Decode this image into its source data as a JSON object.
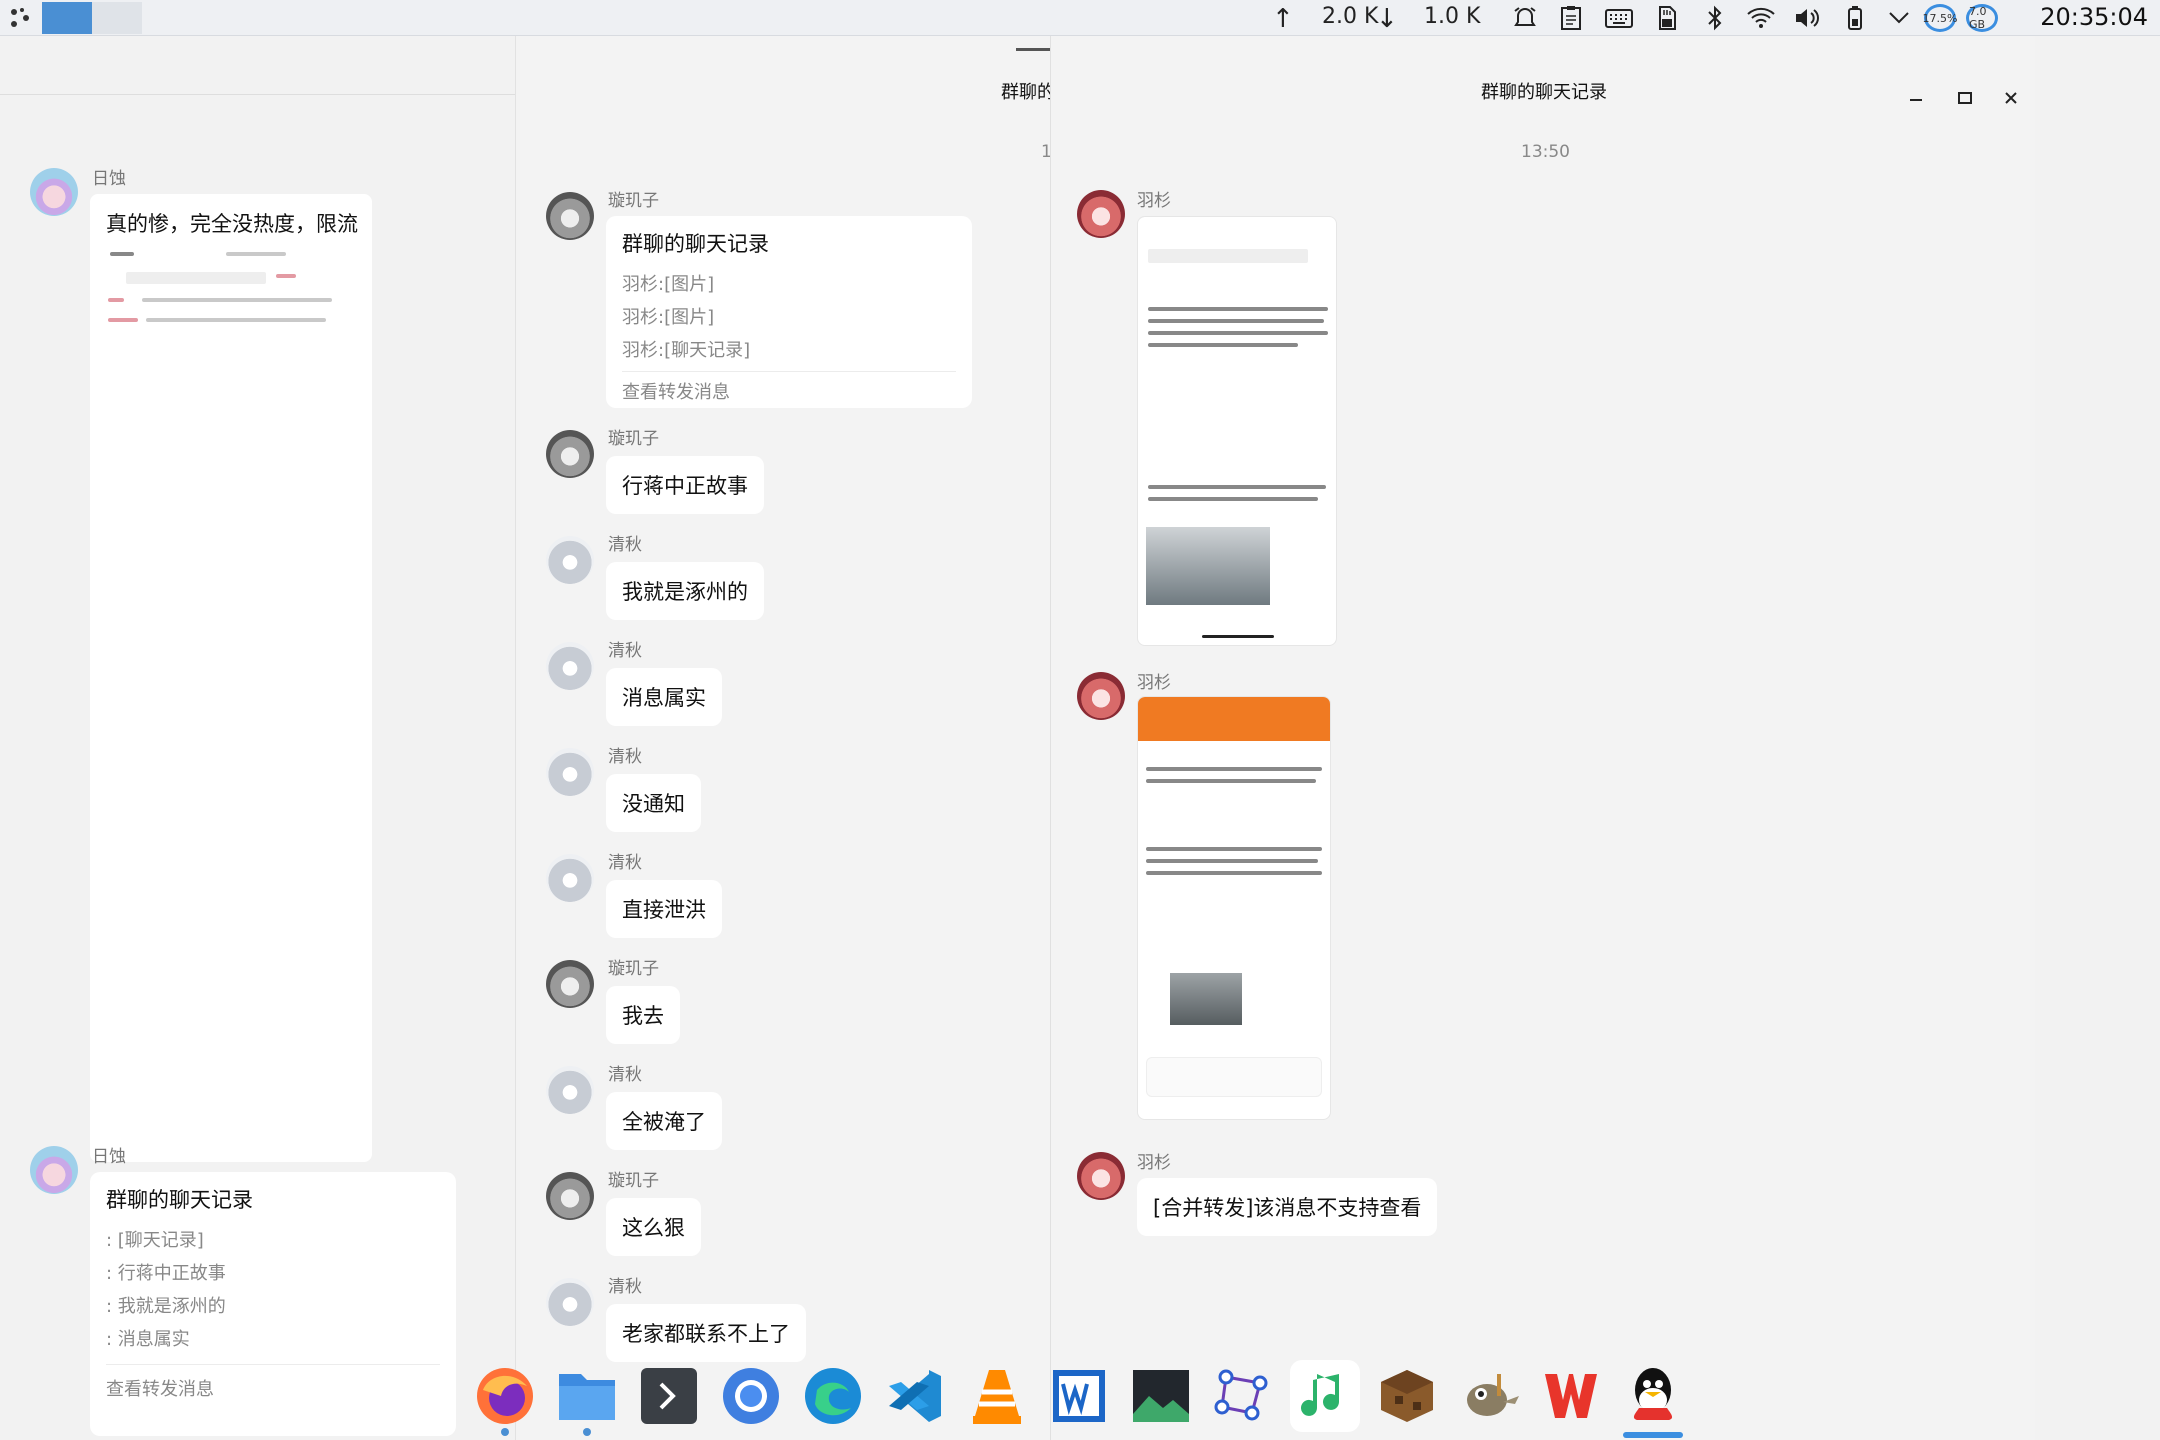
{
  "topbar": {
    "upload_speed": "2.0 K",
    "download_speed": "1.0 K",
    "cpu": "17.5%",
    "mem": "7.0 GB",
    "clock": "20:35:04",
    "icons": [
      "launcher-icon",
      "upload-arrow-icon",
      "download-arrow-icon",
      "alarm-icon",
      "clipboard-icon",
      "keyboard-icon",
      "sd-card-icon",
      "bluetooth-icon",
      "wifi-icon",
      "volume-icon",
      "battery-icon",
      "chevron-down-icon"
    ]
  },
  "left_window": {
    "messages": [
      {
        "sender": "日蚀",
        "text": "真的惨，完全没热度，限流"
      },
      {
        "sender": "日蚀",
        "card_title": "群聊的聊天记录",
        "lines": [
          ": [聊天记录]",
          ": 行蒋中正故事",
          ": 我就是涿州的",
          ": 消息属实"
        ],
        "footer": "查看转发消息"
      }
    ]
  },
  "middle_window": {
    "title": "群聊的",
    "time": "1",
    "card": {
      "sender": "璇玑子",
      "title": "群聊的聊天记录",
      "lines": [
        "羽杉:[图片]",
        "羽杉:[图片]",
        "羽杉:[聊天记录]"
      ],
      "footer": "查看转发消息"
    },
    "messages": [
      {
        "sender": "璇玑子",
        "text": "行蒋中正故事",
        "avatar": "gray"
      },
      {
        "sender": "清秋",
        "text": "我就是涿州的",
        "avatar": "light"
      },
      {
        "sender": "清秋",
        "text": "消息属实",
        "avatar": "light"
      },
      {
        "sender": "清秋",
        "text": "没通知",
        "avatar": "light"
      },
      {
        "sender": "清秋",
        "text": "直接泄洪",
        "avatar": "light"
      },
      {
        "sender": "璇玑子",
        "text": "我去",
        "avatar": "gray"
      },
      {
        "sender": "清秋",
        "text": "全被淹了",
        "avatar": "light"
      },
      {
        "sender": "璇玑子",
        "text": "这么狠",
        "avatar": "gray"
      },
      {
        "sender": "清秋",
        "text": "老家都联系不上了",
        "avatar": "light"
      }
    ]
  },
  "right_window": {
    "title": "群聊的聊天记录",
    "time": "13:50",
    "messages": [
      {
        "sender": "羽杉",
        "kind": "image"
      },
      {
        "sender": "羽杉",
        "kind": "image"
      },
      {
        "sender": "羽杉",
        "text": "[合并转发]该消息不支持查看"
      }
    ],
    "controls": [
      "minimize-icon",
      "maximize-icon",
      "close-icon"
    ]
  },
  "dock": {
    "apps": [
      "firefox-icon",
      "file-manager-icon",
      "terminal-icon",
      "chromium-icon",
      "edge-icon",
      "vscode-icon",
      "vlc-icon",
      "wps-writer-icon",
      "image-viewer-icon",
      "network-graph-icon",
      "music-icon",
      "minecraft-icon",
      "gimp-icon",
      "wps-office-icon",
      "qq-icon"
    ]
  }
}
